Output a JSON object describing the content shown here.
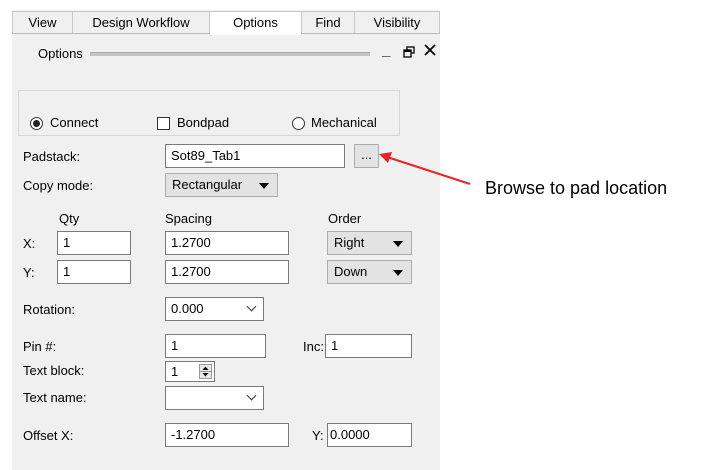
{
  "tabs": [
    {
      "label": "View"
    },
    {
      "label": "Design Workflow"
    },
    {
      "label": "Options"
    },
    {
      "label": "Find"
    },
    {
      "label": "Visibility"
    }
  ],
  "panel": {
    "title": "Options",
    "minimize_glyph": "_",
    "restore_glyph": "🗗",
    "close_glyph": "✕"
  },
  "mode": {
    "connect": "Connect",
    "bondpad": "Bondpad",
    "mechanical": "Mechanical",
    "selected": "Connect"
  },
  "form": {
    "padstack_label": "Padstack:",
    "padstack_value": "Sot89_Tab1",
    "browse_label": "...",
    "copy_mode_label": "Copy mode:",
    "copy_mode_value": "Rectangular",
    "qty_header": "Qty",
    "spacing_header": "Spacing",
    "order_header": "Order",
    "x_label": "X:",
    "y_label": "Y:",
    "x_qty": "1",
    "y_qty": "1",
    "x_spacing": "1.2700",
    "y_spacing": "1.2700",
    "x_order": "Right",
    "y_order": "Down",
    "rotation_label": "Rotation:",
    "rotation_value": "0.000",
    "pin_label": "Pin #:",
    "pin_value": "1",
    "inc_label": "Inc:",
    "inc_value": "1",
    "text_block_label": "Text block:",
    "text_block_value": "1",
    "text_name_label": "Text name:",
    "text_name_value": "",
    "offset_x_label": "Offset X:",
    "offset_x_value": "-1.2700",
    "offset_y_label": "Y:",
    "offset_y_value": "0.0000"
  },
  "annotation": {
    "text": "Browse to pad location",
    "arrow_color": "#e8242a"
  }
}
